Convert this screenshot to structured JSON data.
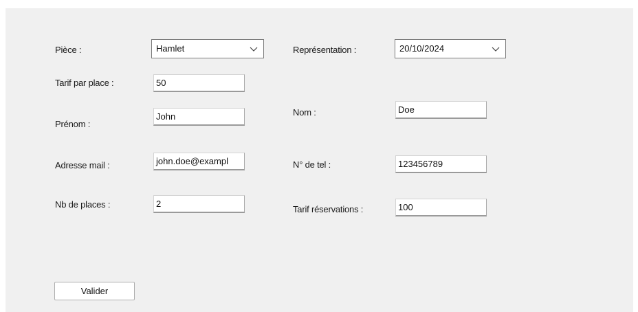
{
  "form": {
    "piece": {
      "label": "Pièce :",
      "selected": "Hamlet"
    },
    "representation": {
      "label": "Représentation :",
      "selected": "20/10/2024"
    },
    "tarif_place": {
      "label": "Tarif par place :",
      "value": "50"
    },
    "prenom": {
      "label": "Prénom :",
      "value": "John"
    },
    "nom": {
      "label": "Nom :",
      "value": "Doe"
    },
    "email": {
      "label": "Adresse mail :",
      "value": "john.doe@exampl"
    },
    "tel": {
      "label": "N° de tel :",
      "value": "123456789"
    },
    "nb_places": {
      "label": "Nb de places :",
      "value": "2"
    },
    "tarif_reservations": {
      "label": "Tarif réservations :",
      "value": "100"
    },
    "submit_label": "Valider"
  },
  "icons": {
    "dropdown": "chevron-down-icon"
  },
  "colors": {
    "panel_background": "#f0f0f0",
    "field_background": "#ffffff",
    "field_border": "#a9a9a9"
  }
}
